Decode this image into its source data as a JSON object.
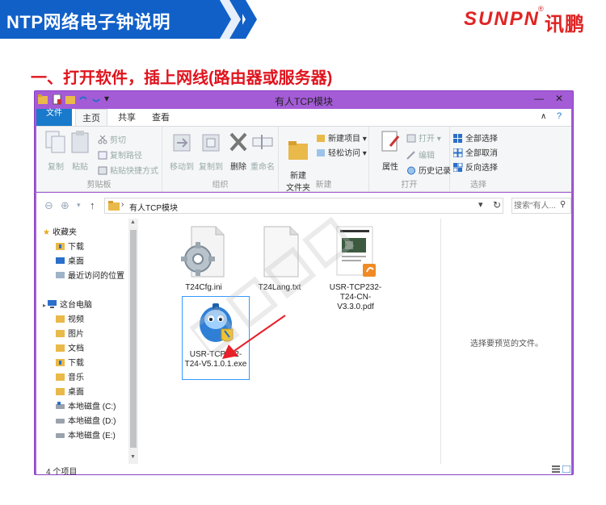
{
  "banner": {
    "title": "NTP网络电子钟说明",
    "brand": "SUNPN",
    "brand_cn": "讯鹏",
    "reg": "®"
  },
  "heading": "一、打开软件，插上网线(路由器或服务器)",
  "window": {
    "title": "有人TCP模块",
    "tabs": [
      "文件",
      "主页",
      "共享",
      "查看"
    ],
    "ribbon": {
      "clipboard": {
        "name": "剪贴板",
        "copy": "复制",
        "paste": "粘贴",
        "cut": "剪切",
        "copy_path": "复制路径",
        "paste_shortcut": "粘贴快捷方式"
      },
      "organize": {
        "name": "组织",
        "move_to": "移动到",
        "copy_to": "复制到",
        "delete": "删除",
        "rename": "重命名"
      },
      "new": {
        "name": "新建",
        "new_folder": "新建\n文件夹",
        "new_item": "新建项目",
        "easy_access": "轻松访问"
      },
      "open": {
        "name": "打开",
        "properties": "属性",
        "open": "打开",
        "edit": "编辑",
        "history": "历史记录"
      },
      "select": {
        "name": "选择",
        "select_all": "全部选择",
        "select_none": "全部取消",
        "invert": "反向选择"
      }
    },
    "address": {
      "path": "有人TCP模块",
      "search_placeholder": "搜索\"有人..."
    },
    "nav": {
      "favorites": "收藏夹",
      "fav_items": [
        "下载",
        "桌面",
        "最近访问的位置"
      ],
      "pc": "这台电脑",
      "pc_items": [
        "视频",
        "图片",
        "文档",
        "下载",
        "音乐",
        "桌面",
        "本地磁盘 (C:)",
        "本地磁盘 (D:)",
        "本地磁盘 (E:)"
      ]
    },
    "files": [
      {
        "name": "T24Cfg.ini"
      },
      {
        "name": "T24Lang.txt"
      },
      {
        "name": "USR-TCP232-T24-CN-V3.3.0.pdf"
      },
      {
        "name": "USR-TCP232-T24-V5.1.0.1.exe"
      }
    ],
    "preview_text": "选择要预览的文件。",
    "status": "4 个项目"
  },
  "colors": {
    "banner_blue": "#1160c8",
    "brand_red": "#e02424",
    "window_frame": "#a45bd6",
    "file_tab": "#1979ca",
    "arrow": "#e8202a"
  }
}
